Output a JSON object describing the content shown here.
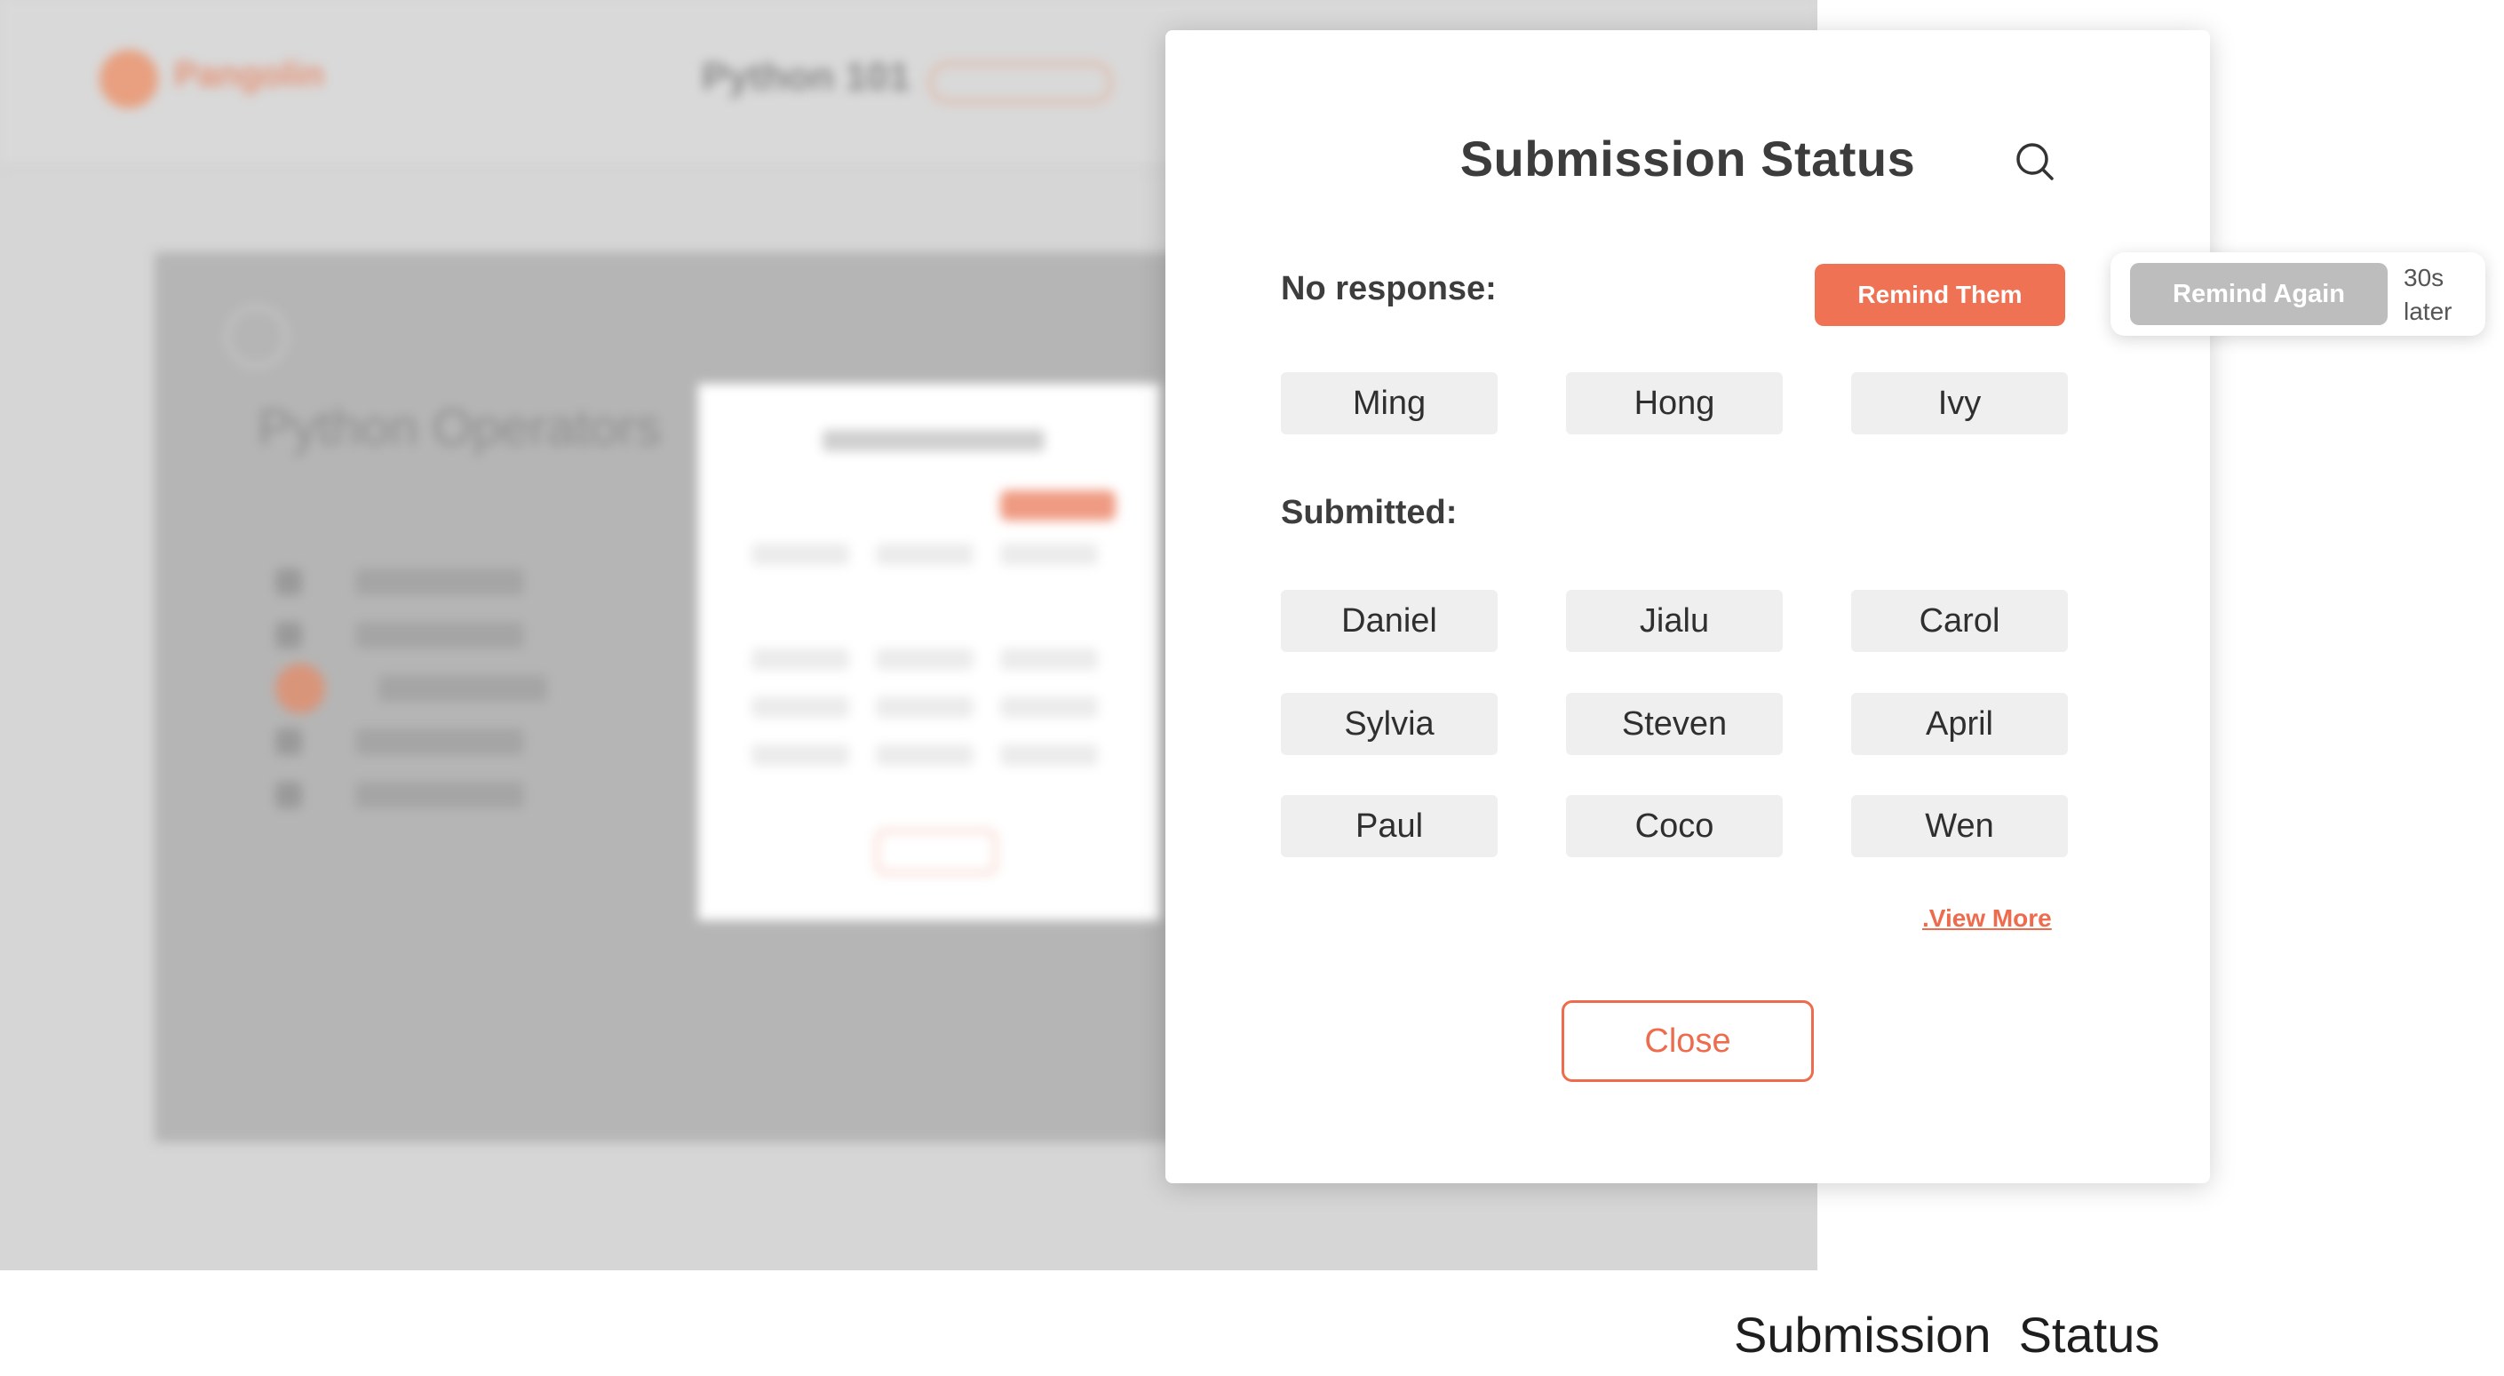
{
  "background": {
    "app_name": "Pangolin",
    "course_title": "Python 101",
    "page_title": "Python Operators"
  },
  "modal": {
    "title": "Submission Status",
    "search_icon": "search-icon",
    "no_response": {
      "label": "No response:",
      "remind_button": "Remind Them",
      "students": [
        "Ming",
        "Hong",
        "Ivy"
      ]
    },
    "submitted": {
      "label": "Submitted:",
      "students": [
        "Daniel",
        "Jialu",
        "Carol",
        "Sylvia",
        "Steven",
        "April",
        "Paul",
        "Coco",
        "Wen"
      ]
    },
    "view_more": ".View More",
    "close_button": "Close"
  },
  "callout": {
    "remind_again_button": "Remind Again",
    "note": "30s later"
  },
  "caption": "Submission  Status",
  "colors": {
    "accent": "#f07255",
    "disabled": "#bdbdbd",
    "chip_bg": "#efefef",
    "overlay_bg": "#d6d6d6"
  }
}
